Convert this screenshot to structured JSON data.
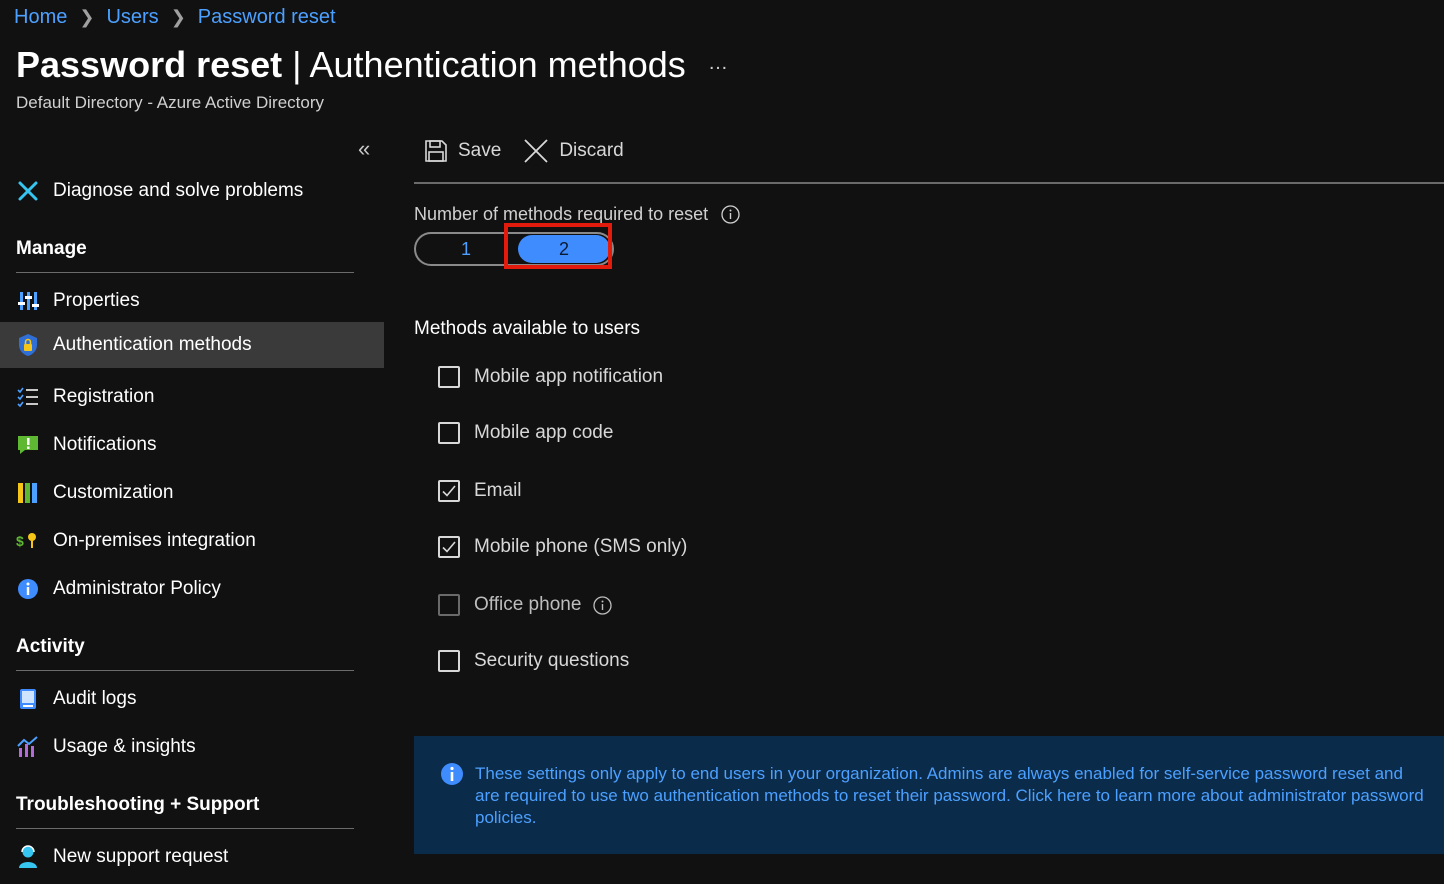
{
  "breadcrumb": {
    "home": "Home",
    "users": "Users",
    "current": "Password reset"
  },
  "header": {
    "title_bold": "Password reset",
    "title_rest": " | Authentication methods",
    "more": "…",
    "subtitle": "Default Directory - Azure Active Directory"
  },
  "sidebar": {
    "collapse": "«",
    "diagnose": "Diagnose and solve problems",
    "manage_title": "Manage",
    "items": [
      {
        "label": "Properties",
        "icon": "properties-icon"
      },
      {
        "label": "Authentication methods",
        "icon": "shield-lock-icon",
        "active": true
      },
      {
        "label": "Registration",
        "icon": "checklist-icon"
      },
      {
        "label": "Notifications",
        "icon": "notification-icon"
      },
      {
        "label": "Customization",
        "icon": "customization-icon"
      },
      {
        "label": "On-premises integration",
        "icon": "on-premises-icon"
      },
      {
        "label": "Administrator Policy",
        "icon": "info-icon"
      }
    ],
    "activity_title": "Activity",
    "activity_items": [
      {
        "label": "Audit logs",
        "icon": "audit-log-icon"
      },
      {
        "label": "Usage & insights",
        "icon": "usage-insights-icon"
      }
    ],
    "support_title": "Troubleshooting + Support",
    "support_items": [
      {
        "label": "New support request",
        "icon": "support-person-icon"
      }
    ]
  },
  "toolbar": {
    "save": "Save",
    "discard": "Discard"
  },
  "methods_required": {
    "label": "Number of methods required to reset",
    "option1": "1",
    "option2": "2",
    "selected": "2"
  },
  "methods": {
    "title": "Methods available to users",
    "items": [
      {
        "label": "Mobile app notification",
        "checked": false,
        "disabled": false
      },
      {
        "label": "Mobile app code",
        "checked": false,
        "disabled": false
      },
      {
        "label": "Email",
        "checked": true,
        "disabled": false
      },
      {
        "label": "Mobile phone (SMS only)",
        "checked": true,
        "disabled": false
      },
      {
        "label": "Office phone",
        "checked": false,
        "disabled": true,
        "info": true
      },
      {
        "label": "Security questions",
        "checked": false,
        "disabled": false
      }
    ]
  },
  "info_banner": {
    "text": "These settings only apply to end users in your organization. Admins are always enabled for self-service password reset and are required to use two authentication methods to reset their password. Click here to learn more about administrator password policies."
  },
  "colors": {
    "accent": "#4ca0ff",
    "toggle_selected": "#3f8cff",
    "highlight": "#e31b0c",
    "banner_bg": "#0b2b4a"
  }
}
